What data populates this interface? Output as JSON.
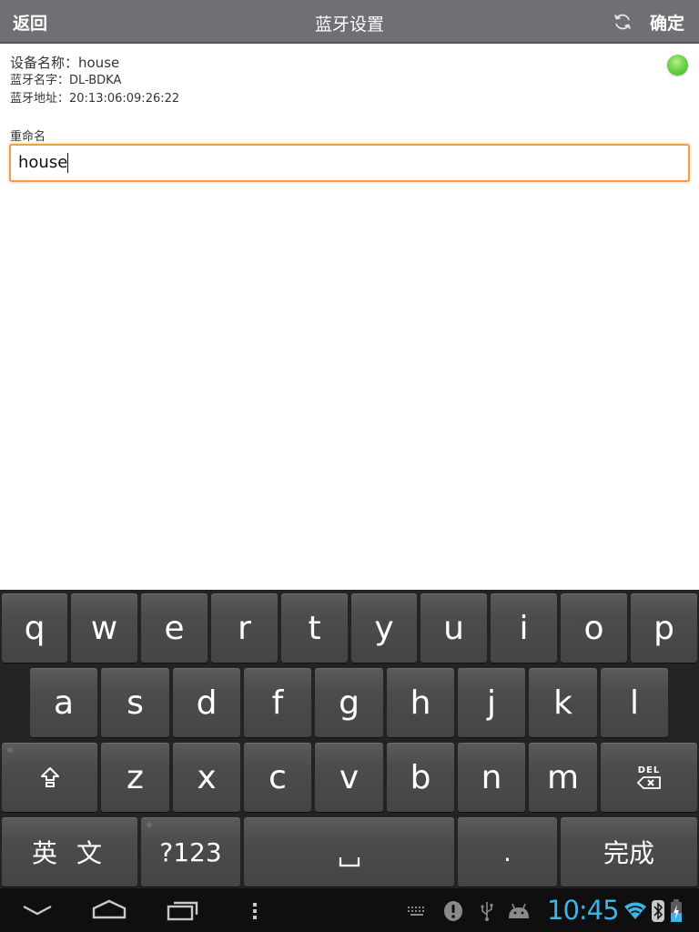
{
  "titlebar": {
    "back_label": "返回",
    "title": "蓝牙设置",
    "refresh_icon": "refresh-icon",
    "confirm_label": "确定"
  },
  "device": {
    "name_line": "设备名称：house",
    "bt_name_line": "蓝牙名字：DL-BDKA",
    "bt_address_line": "蓝牙地址：20:13:06:09:26:22",
    "status_color": "#5cc83c"
  },
  "rename": {
    "label": "重命名",
    "value": "house"
  },
  "keyboard": {
    "row1": [
      "q",
      "w",
      "e",
      "r",
      "t",
      "y",
      "u",
      "i",
      "o",
      "p"
    ],
    "row2": [
      "a",
      "s",
      "d",
      "f",
      "g",
      "h",
      "j",
      "k",
      "l"
    ],
    "row3": [
      "z",
      "x",
      "c",
      "v",
      "b",
      "n",
      "m"
    ],
    "shift_icon": "shift-icon",
    "delete_label": "DEL",
    "lang_label": "英 文",
    "symbols_label": "?123",
    "space_label": "␣",
    "period_label": ".",
    "done_label": "完成"
  },
  "statusbar": {
    "time": "10:45",
    "accent_color": "#3db5e6",
    "icons": [
      "keyboard-icon",
      "alert-icon",
      "usb-icon",
      "android-debug-icon",
      "wifi-icon",
      "bluetooth-icon",
      "battery-charging-icon"
    ]
  },
  "navbar": {
    "icons": [
      "back-hide-keyboard-icon",
      "home-icon",
      "recent-apps-icon",
      "menu-icon"
    ]
  }
}
